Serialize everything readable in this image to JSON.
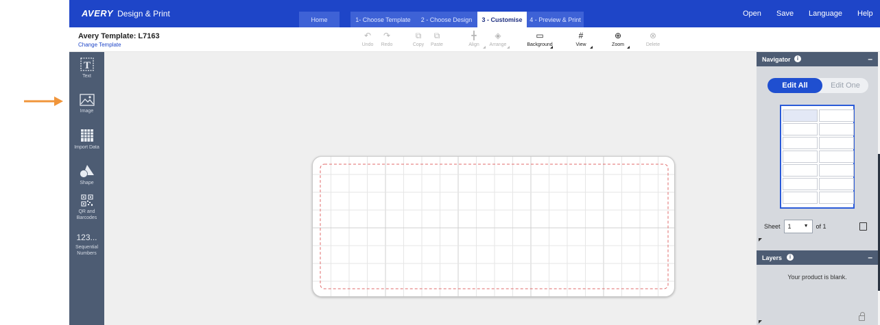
{
  "header": {
    "logo_brand": "AVERY",
    "logo_text": "Design & Print",
    "tabs": [
      {
        "label": "Home",
        "active": false
      },
      {
        "label": "1- Choose Template",
        "active": false
      },
      {
        "label": "2 - Choose Design",
        "active": false
      },
      {
        "label": "3 - Customise",
        "active": true
      },
      {
        "label": "4 - Preview & Print",
        "active": false
      }
    ],
    "links": [
      "Open",
      "Save",
      "Language",
      "Help"
    ]
  },
  "toolbar": {
    "template_title": "Avery Template: L7163",
    "change_template": "Change Template",
    "tools": [
      {
        "label": "Undo",
        "icon": "undo-icon",
        "enabled": false
      },
      {
        "label": "Redo",
        "icon": "redo-icon",
        "enabled": false
      },
      {
        "label": "Copy",
        "icon": "copy-icon",
        "enabled": false
      },
      {
        "label": "Paste",
        "icon": "paste-icon",
        "enabled": false
      },
      {
        "label": "Align",
        "icon": "align-icon",
        "enabled": false
      },
      {
        "label": "Arrange",
        "icon": "arrange-icon",
        "enabled": false
      },
      {
        "label": "Background",
        "icon": "background-icon",
        "enabled": true
      },
      {
        "label": "View",
        "icon": "grid-icon",
        "enabled": true
      },
      {
        "label": "Zoom",
        "icon": "zoom-icon",
        "enabled": true
      },
      {
        "label": "Delete",
        "icon": "delete-icon",
        "enabled": false
      }
    ]
  },
  "sidebar": {
    "items": [
      {
        "label": "Text",
        "icon": "text-icon"
      },
      {
        "label": "Image",
        "icon": "image-icon"
      },
      {
        "label": "Import Data",
        "icon": "table-icon"
      },
      {
        "label": "Shape",
        "icon": "shape-icon"
      },
      {
        "label": "QR and Barcodes",
        "icon": "qr-code-icon"
      },
      {
        "label": "Sequential Numbers",
        "icon": "sequential-numbers-icon",
        "glyph": "123..."
      }
    ]
  },
  "navigator": {
    "title": "Navigator",
    "edit_all": "Edit All",
    "edit_one": "Edit One",
    "sheet_label": "Sheet",
    "sheet_value": "1",
    "sheet_of": "of 1"
  },
  "layers": {
    "title": "Layers",
    "empty_message": "Your product is blank."
  },
  "colors": {
    "nav_blue": "#1e45c8",
    "sidebar_slate": "#4d5c73",
    "arrow_orange": "#f0953b",
    "bleed_red": "#e06a6a"
  }
}
